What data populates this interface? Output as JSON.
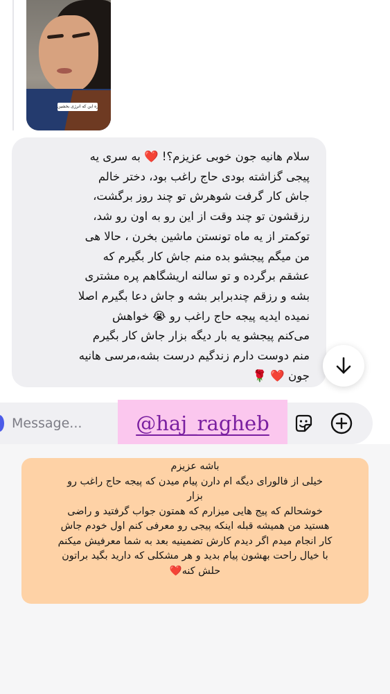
{
  "story_reply": {
    "caption": "اندازه این که انرژی بخشین"
  },
  "received_message": {
    "text": "سلام هانیه جون خوبی عزیزم؟! ❤️ به سری یه\nپیجی گزاشته بودی حاج راغب بود، دختر خالم\nجاش کار گرفت شوهرش تو چند روز برگشت،\nرزقشون تو چند وقت از این رو به اون رو شد،\nتوکمتر از یه ماه تونستن ماشین بخرن ، حالا هی\nمن میگم پیجشو بده منم جاش کار بگیرم که\nعشقم برگرده و تو سالنه اریشگاهم پره مشتری\nبشه و رزقم چندبرابر بشه و جاش دعا بگیرم اصلا\nنمیده ایدیه پیجه حاج راغب رو 😭 خواهش\nمی‌کنم پیجشو یه بار دیگه بزار جاش کار بگیرم\nمنم دوست دارم زندگیم درست بشه،مرسی هانیه\nجون ❤️ 🌹"
  },
  "composer": {
    "placeholder": "Message..."
  },
  "overlay": {
    "handle": "@haj_ragheb"
  },
  "note": {
    "text": "باشه عزیزم\nخیلی از فالورای دیگه ام دارن پیام میدن که پیجه حاج راغب رو\nبزار\nخوشحالم که پیج هایی میزارم که همتون جواب گرفتید و راضی\nهستید من همیشه قبله اینکه پیجی رو معرفی کنم اول خودم جاش\nکار انجام میدم اگر دیدم کارش تضمینیه بعد به شما معرفیش میکنم\nبا خیال راحت بهشون پیام بدید و هر مشکلی که دارید بگید براتون\nحلش کنه❤️"
  },
  "colors": {
    "bubble": "#efeff2",
    "note_bg": "#fed2a6",
    "overlay_bg": "#fbc7ee",
    "overlay_text": "#7a1fa0"
  },
  "icons": [
    "arrow-down-icon",
    "sticker-icon",
    "plus-circle-icon"
  ]
}
